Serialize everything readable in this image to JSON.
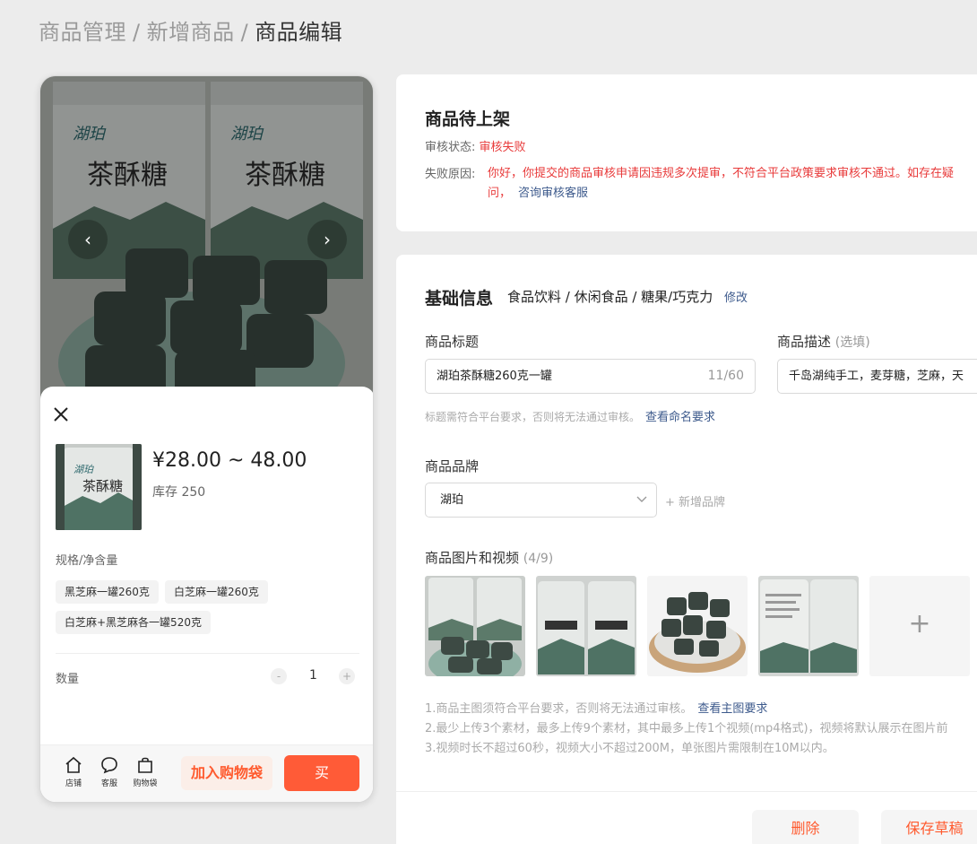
{
  "breadcrumb": {
    "items": [
      "商品管理",
      "新增商品"
    ],
    "current": "商品编辑",
    "separator": "/"
  },
  "preview": {
    "close_icon": "close-icon",
    "price": "¥28.00 ~ 48.00",
    "stock": "库存 250",
    "spec_title": "规格/净含量",
    "specs": [
      "黑芝麻一罐260克",
      "白芝麻一罐260克",
      "白芝麻+黑芝麻各一罐520克"
    ],
    "quantity_label": "数量",
    "quantity_value": "1",
    "minus": "-",
    "plus": "+",
    "jar_brand": "湖珀",
    "jar_product": "茶酥糖",
    "bottom": {
      "shop": "店铺",
      "service": "客服",
      "bag": "购物袋",
      "add_to_cart": "加入购物袋",
      "buy": "买"
    },
    "colors": {
      "accent": "#ff5b37",
      "accent_light": "#fbeee8"
    }
  },
  "status_card": {
    "title": "商品待上架",
    "review_label": "审核状态:",
    "review_value": "审核失败",
    "reason_label": "失败原因:",
    "reason_text": "你好，你提交的商品审核申请因违规多次提审，不符合平台政策要求审核不通过。如存在疑问，",
    "reason_link": "咨询审核客服"
  },
  "basic_info": {
    "title": "基础信息",
    "category": "食品饮料 / 休闲食品 / 糖果/巧克力",
    "modify": "修改",
    "product_title_label": "商品标题",
    "product_title_value": "湖珀茶酥糖260克一罐",
    "product_title_count": "11/60",
    "title_hint": "标题需符合平台要求，否则将无法通过审核。",
    "title_hint_link": "查看命名要求",
    "desc_label": "商品描述",
    "desc_optional": "(选填)",
    "desc_value": "千岛湖纯手工，麦芽糖，芝麻，天",
    "brand_label": "商品品牌",
    "brand_value": "湖珀",
    "add_brand": "+ 新增品牌",
    "media_label": "商品图片和视频",
    "media_count": "(4/9)",
    "add_tile": "+",
    "rule1": "1.商品主图须符合平台要求，否则将无法通过审核。",
    "rule1_link": "查看主图要求",
    "rule2": "2.最少上传3个素材，最多上传9个素材，其中最多上传1个视频(mp4格式)，视频将默认展示在图片前",
    "rule3": "3.视频时长不超过60秒，视频大小不超过200M，单张图片需限制在10M以内。",
    "delete": "删除",
    "save_draft": "保存草稿"
  }
}
